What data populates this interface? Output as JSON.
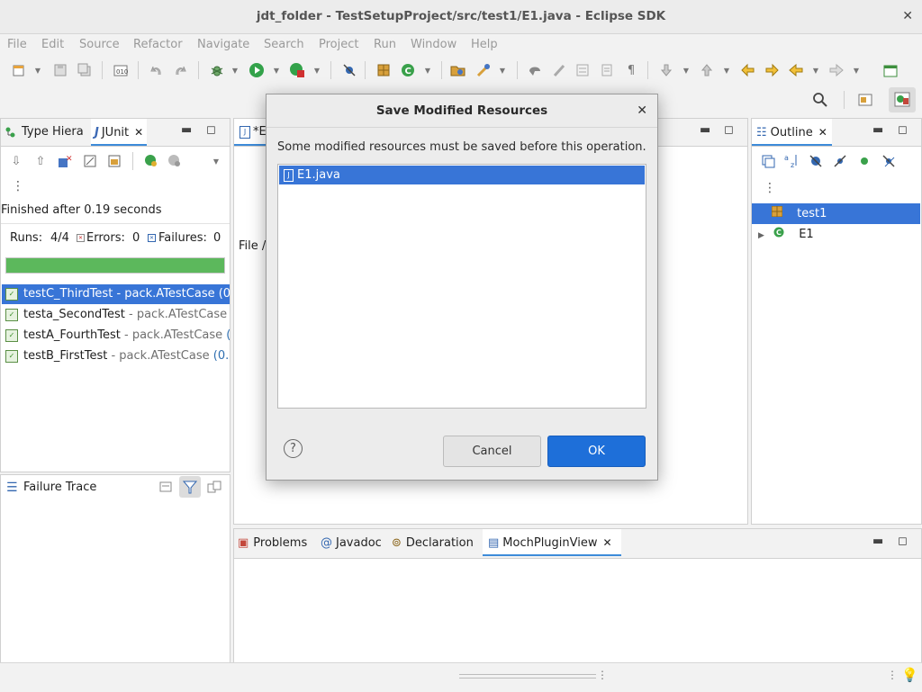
{
  "window": {
    "title": "jdt_folder - TestSetupProject/src/test1/E1.java - Eclipse SDK",
    "close_glyph": "✕"
  },
  "menu": [
    "File",
    "Edit",
    "Source",
    "Refactor",
    "Navigate",
    "Search",
    "Project",
    "Run",
    "Window",
    "Help"
  ],
  "left_panel": {
    "tabs": [
      {
        "label": "Type Hiera"
      },
      {
        "label": "JUnit"
      }
    ],
    "finished_text": "Finished after 0.19 seconds",
    "runs_label": "Runs:",
    "runs_value": "4/4",
    "errors_label": "Errors:",
    "errors_value": "0",
    "failures_label": "Failures:",
    "failures_value": "0",
    "progress": 1.0,
    "progress_color": "#5cb85c",
    "tests": [
      {
        "name": "testC_ThirdTest",
        "meta": " - pack.ATestCase",
        "time": " (0"
      },
      {
        "name": "testa_SecondTest",
        "meta": " - pack.ATestCase",
        "time": ""
      },
      {
        "name": "testA_FourthTest",
        "meta": " - pack.ATestCase",
        "time": " ("
      },
      {
        "name": "testB_FirstTest",
        "meta": " - pack.ATestCase",
        "time": " (0."
      }
    ],
    "failure_trace_label": "Failure Trace"
  },
  "editor": {
    "tab_label": "*E",
    "file_text": "File /"
  },
  "outline": {
    "tab_label": "Outline",
    "items": [
      {
        "label": "test1"
      },
      {
        "label": "E1"
      }
    ]
  },
  "bottom_panel": {
    "tabs": [
      {
        "label": "Problems"
      },
      {
        "label": "Javadoc"
      },
      {
        "label": "Declaration"
      },
      {
        "label": "MochPluginView"
      }
    ]
  },
  "dialog": {
    "title": "Save Modified Resources",
    "message": "Some modified resources must be saved before this operation.",
    "files": [
      {
        "label": "E1.java"
      }
    ],
    "help_glyph": "?",
    "cancel_label": "Cancel",
    "ok_label": "OK"
  },
  "colors": {
    "accent": "#3875d7",
    "ok_button": "#1e6fd9",
    "progress": "#5cb85c"
  }
}
